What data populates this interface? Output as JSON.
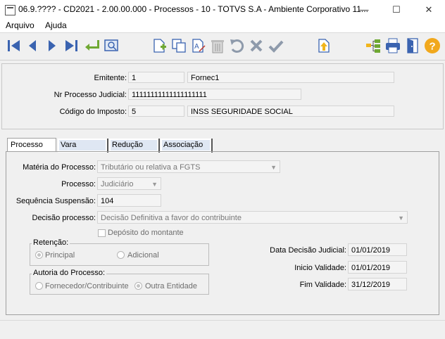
{
  "window": {
    "title": "06.9.???? - CD2021 - 2.00.00.000 - Processos - 10 - TOTVS S.A - Ambiente Corporativo 11...",
    "minimize": "—",
    "maximize": "☐",
    "close": "✕"
  },
  "menu": {
    "items": [
      "Arquivo",
      "Ajuda"
    ]
  },
  "header": {
    "emitente_label": "Emitente:",
    "emitente_code": "1",
    "emitente_name": "Fornec1",
    "processo_label": "Nr Processo Judicial:",
    "processo_value": "11111111111111111111",
    "imposto_label": "Código do Imposto:",
    "imposto_code": "5",
    "imposto_name": "INSS SEGURIDADE SOCIAL"
  },
  "tabs": [
    "Processo",
    "Vara",
    "Redução",
    "Associação"
  ],
  "form": {
    "materia_label": "Matéria do Processo:",
    "materia_value": "Tributário ou relativa a FGTS",
    "processo_label": "Processo:",
    "processo_value": "Judiciário",
    "sequencia_label": "Sequência Suspensão:",
    "sequencia_value": "104",
    "decisao_label": "Decisão processo:",
    "decisao_value": "Decisão Definitiva a favor do contribuinte",
    "deposito_label": "Depósito do montante",
    "retencao_legend": "Retenção:",
    "retencao_options": [
      "Principal",
      "Adicional"
    ],
    "autoria_legend": "Autoria do Processo:",
    "autoria_options": [
      "Fornecedor/Contribuinte",
      "Outra Entidade"
    ],
    "data_decisao_label": "Data Decisão Judicial:",
    "data_decisao_value": "01/01/2019",
    "inicio_label": "Inicio Validade:",
    "inicio_value": "01/01/2019",
    "fim_label": "Fim Validade:",
    "fim_value": "31/12/2019"
  }
}
